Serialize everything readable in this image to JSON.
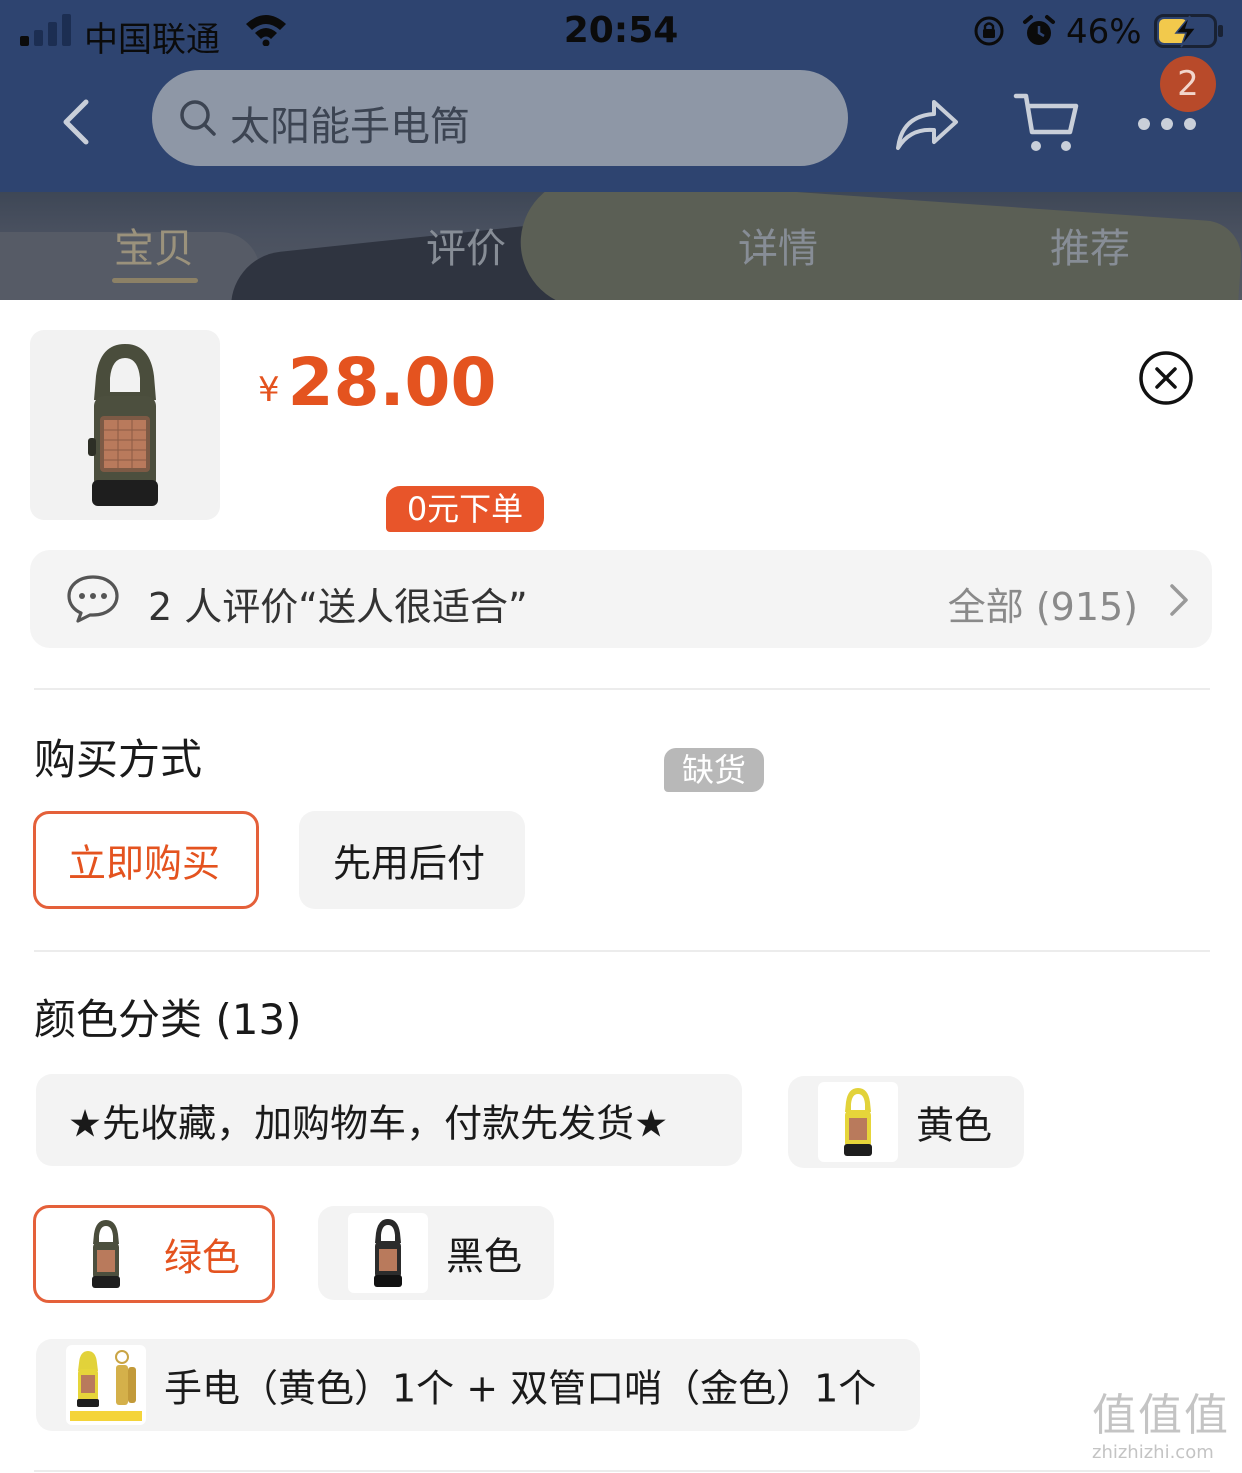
{
  "status_bar": {
    "carrier": "中国联通",
    "time": "20:54",
    "battery_percent": "46%"
  },
  "nav": {
    "search_placeholder": "太阳能手电筒",
    "cart_badge": "2"
  },
  "tabs": [
    {
      "label": "宝贝",
      "active": true
    },
    {
      "label": "评价",
      "active": false
    },
    {
      "label": "详情",
      "active": false
    },
    {
      "label": "推荐",
      "active": false
    }
  ],
  "product": {
    "currency_symbol": "¥",
    "price": "28.00"
  },
  "review_bar": {
    "summary": "2 人评价“送人很适合”",
    "all_link": "全部 (915)"
  },
  "purchase_method": {
    "title": "购买方式",
    "options": [
      {
        "label": "立即购买",
        "selected": true
      },
      {
        "label": "先用后付",
        "selected": false,
        "tag": "0元下单"
      }
    ]
  },
  "color_category": {
    "title": "颜色分类 (13)",
    "options": [
      {
        "label": "★先收藏，加购物车，付款先发货★",
        "selected": false,
        "tag": "缺货"
      },
      {
        "label": "黄色",
        "selected": false
      },
      {
        "label": "绿色",
        "selected": true
      },
      {
        "label": "黑色",
        "selected": false
      },
      {
        "label": "手电（黄色）1个 + 双管口哨（金色）1个",
        "selected": false
      }
    ]
  },
  "watermark": {
    "logo_text": "值值值",
    "url_text": "zhizhizhi.com"
  },
  "colors": {
    "header_blue": "#2e4470",
    "accent_orange": "#e4531f",
    "option_bg": "#f3f3f3"
  }
}
